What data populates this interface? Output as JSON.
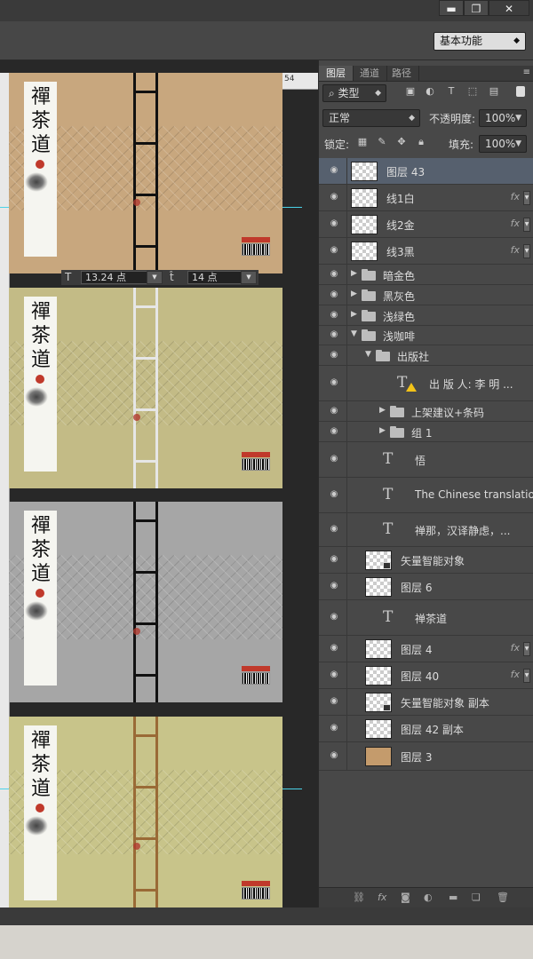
{
  "window": {
    "minimize": "▬",
    "restore": "❐",
    "close": "✕"
  },
  "options_bar": {
    "workspace": "基本功能"
  },
  "ruler": {
    "right_number": "54"
  },
  "covers": {
    "title_chars": [
      "禪",
      "茶",
      "道"
    ],
    "english": "The Chinese translation",
    "colors": [
      "#c8a77e",
      "#c3bb86",
      "#a6a6a6",
      "#c8c48a"
    ],
    "ladder_colors": [
      "#111111",
      "#e6e6e6",
      "#111111",
      "#9a6a36"
    ]
  },
  "char_bar": {
    "font_size": "13.24 点",
    "leading": "14 点"
  },
  "panel": {
    "tabs": [
      "图层",
      "通道",
      "路径"
    ],
    "filter_type": "类型",
    "blend_mode": "正常",
    "opacity_label": "不透明度:",
    "opacity_value": "100%",
    "lock_label": "锁定:",
    "fill_label": "填充:",
    "fill_value": "100%"
  },
  "layers": [
    {
      "name": "图层 43",
      "kind": "image",
      "selected": true
    },
    {
      "name": "线1白",
      "kind": "image",
      "fx": "fx"
    },
    {
      "name": "线2金",
      "kind": "image",
      "fx": "fx"
    },
    {
      "name": "线3黑",
      "kind": "image",
      "fx": "fx"
    },
    {
      "name": "暗金色",
      "kind": "group"
    },
    {
      "name": "黑灰色",
      "kind": "group"
    },
    {
      "name": "浅绿色",
      "kind": "group"
    },
    {
      "name": "浅咖啡",
      "kind": "group-open"
    },
    {
      "name": "出版社",
      "kind": "group-open"
    },
    {
      "name": "出 版 人: 李  明 ...",
      "kind": "text-warn"
    },
    {
      "name": "上架建议+条码",
      "kind": "group"
    },
    {
      "name": "组 1",
      "kind": "group"
    },
    {
      "name": "悟",
      "kind": "text"
    },
    {
      "name": "The Chinese translation",
      "kind": "text"
    },
    {
      "name": "禅那，汉译静虑，...",
      "kind": "text"
    },
    {
      "name": "矢量智能对象",
      "kind": "smart"
    },
    {
      "name": "图层 6",
      "kind": "image"
    },
    {
      "name": "禅茶道",
      "kind": "text"
    },
    {
      "name": "图层 4",
      "kind": "image",
      "fx": "fx"
    },
    {
      "name": "图层 40",
      "kind": "image",
      "fx": "fx"
    },
    {
      "name": "矢量智能对象 副本",
      "kind": "smart"
    },
    {
      "name": "图层 42 副本",
      "kind": "image"
    },
    {
      "name": "图层 3",
      "kind": "fill",
      "color": "#c49b6c"
    }
  ],
  "icons": {
    "eye": "◉",
    "bottom": [
      "link-icon",
      "fx-icon",
      "mask-icon",
      "adjustment-icon",
      "folder-icon",
      "new-layer-icon",
      "trash-icon"
    ]
  }
}
